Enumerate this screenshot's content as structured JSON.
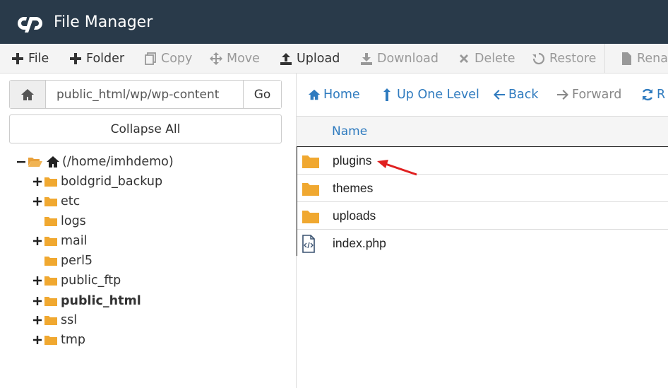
{
  "header": {
    "title": "File Manager",
    "logo_icon": "cpanel-logo-icon"
  },
  "toolbar": {
    "items": [
      {
        "label": "File",
        "icon": "plus-icon",
        "enabled": true
      },
      {
        "label": "Folder",
        "icon": "plus-icon",
        "enabled": true
      },
      {
        "label": "Copy",
        "icon": "copy-icon",
        "enabled": false
      },
      {
        "label": "Move",
        "icon": "move-icon",
        "enabled": false
      },
      {
        "label": "Upload",
        "icon": "upload-icon",
        "enabled": true
      },
      {
        "label": "Download",
        "icon": "download-icon",
        "enabled": false
      },
      {
        "label": "Delete",
        "icon": "close-icon",
        "enabled": false
      },
      {
        "label": "Restore",
        "icon": "restore-icon",
        "enabled": false
      },
      {
        "label": "Renan",
        "icon": "file-icon",
        "enabled": false
      }
    ]
  },
  "path_bar": {
    "value": "public_html/wp/wp-content",
    "go_label": "Go"
  },
  "collapse_label": "Collapse All",
  "tree": {
    "root": "(/home/imhdemo)",
    "items": [
      {
        "label": "boldgrid_backup",
        "expandable": true,
        "bold": false
      },
      {
        "label": "etc",
        "expandable": true,
        "bold": false
      },
      {
        "label": "logs",
        "expandable": false,
        "bold": false
      },
      {
        "label": "mail",
        "expandable": true,
        "bold": false
      },
      {
        "label": "perl5",
        "expandable": false,
        "bold": false
      },
      {
        "label": "public_ftp",
        "expandable": true,
        "bold": false
      },
      {
        "label": "public_html",
        "expandable": true,
        "bold": true
      },
      {
        "label": "ssl",
        "expandable": true,
        "bold": false
      },
      {
        "label": "tmp",
        "expandable": true,
        "bold": false
      }
    ]
  },
  "nav": {
    "items": [
      {
        "label": "Home",
        "icon": "home-icon",
        "enabled": true
      },
      {
        "label": "Up One Level",
        "icon": "up-arrow-icon",
        "enabled": true
      },
      {
        "label": "Back",
        "icon": "left-arrow-icon",
        "enabled": true
      },
      {
        "label": "Forward",
        "icon": "right-arrow-icon",
        "enabled": false
      },
      {
        "label": "R",
        "icon": "refresh-icon",
        "enabled": true
      }
    ]
  },
  "file_table": {
    "column_name": "Name",
    "rows": [
      {
        "name": "plugins",
        "type": "folder"
      },
      {
        "name": "themes",
        "type": "folder"
      },
      {
        "name": "uploads",
        "type": "folder"
      },
      {
        "name": "index.php",
        "type": "php-file"
      }
    ]
  },
  "colors": {
    "header_bg": "#293a4a",
    "link": "#2f7bbf",
    "folder": "#f0a830",
    "annotation_arrow": "#e02020"
  }
}
